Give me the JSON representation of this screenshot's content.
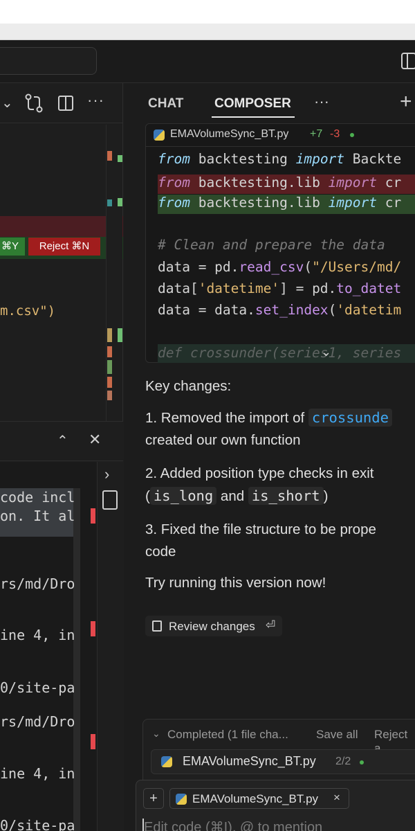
{
  "left_editor": {
    "accept_shortcut": "⌘Y",
    "reject_label": "Reject ⌘N",
    "visible_code": "m.csv\")"
  },
  "terminal": {
    "lines": [
      "code incl",
      "on. It al",
      "rs/md/Dro",
      "ine 4, in",
      "0/site-pa",
      "rs/md/Dro",
      "ine 4, in",
      "0/site-pa"
    ]
  },
  "right_panel": {
    "tabs": {
      "chat": "CHAT",
      "composer": "COMPOSER"
    },
    "file_header": {
      "name": "EMAVolumeSync_BT.py",
      "added": "+7",
      "removed": "-3"
    },
    "code": {
      "line1": [
        "from",
        " backtesting ",
        "import",
        " Backte"
      ],
      "line2_removed": [
        "from",
        " backtesting.lib ",
        "import",
        " cr"
      ],
      "line3_added": [
        "from",
        " backtesting.lib ",
        "import",
        " cr"
      ],
      "comment": "# Clean and prepare the data",
      "line5": [
        "data = pd.",
        "read_csv",
        "(",
        "\"/Users/md/"
      ],
      "line6": [
        "data[",
        "'datetime'",
        "] = pd.",
        "to_datet"
      ],
      "line7": [
        "data = data.",
        "set_index",
        "(",
        "'datetim"
      ],
      "line8": "def crossunder(series1, series"
    },
    "message": {
      "heading": "Key changes:",
      "item1_prefix": "1. Removed the import of ",
      "item1_code": "crossunde",
      "item1_cont": "created our own function",
      "item2": "2. Added position type checks in exit",
      "item2_open": "(",
      "item2_code1": "is_long",
      "item2_and": " and ",
      "item2_code2": "is_short",
      "item2_close": ")",
      "item3": "3. Fixed the file structure to be prope",
      "item3_cont": "code",
      "closing": "Try running this version now!"
    },
    "review_button": {
      "label": "Review changes",
      "enter_glyph": "⏎"
    },
    "completed": {
      "label": "Completed (1 file cha...",
      "save_all": "Save all",
      "reject_all": "Reject a",
      "file": "EMAVolumeSync_BT.py",
      "count": "2/2"
    },
    "input": {
      "plus": "+",
      "context_file": "EMAVolumeSync_BT.py",
      "close": "×",
      "placeholder": "Edit code (⌘I), @ to mention"
    }
  },
  "colors": {
    "accept_green": "#2f7d32",
    "reject_red": "#a11d1d",
    "added_count": "#6fbf73",
    "removed_count": "#e5534b",
    "inline_code_blue": "#3fa9f5"
  }
}
